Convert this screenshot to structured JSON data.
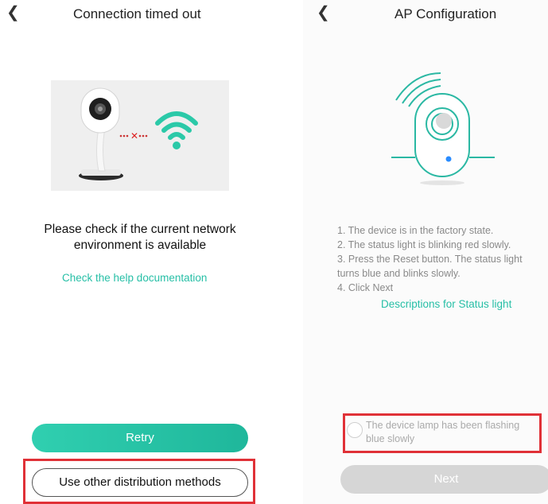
{
  "left": {
    "title": "Connection timed out",
    "back_icon": "chevron-left-icon",
    "message": "Please check if the current network environment is available",
    "help_link": "Check the help documentation",
    "retry_label": "Retry",
    "other_methods_label": "Use other distribution methods"
  },
  "right": {
    "title": "AP Configuration",
    "back_icon": "chevron-left-icon",
    "steps": [
      "1. The device is in the factory state.",
      "2. The status light is blinking red slowly.",
      "3. Press the Reset button. The status light",
      "turns blue and blinks slowly.",
      "4. Click Next"
    ],
    "status_link": "Descriptions for Status light",
    "confirm_label": "The device lamp has been flashing blue slowly",
    "next_label": "Next"
  },
  "colors": {
    "accent": "#26bfa6",
    "highlight_box": "#e03137",
    "disabled_button": "#d6d6d6"
  }
}
